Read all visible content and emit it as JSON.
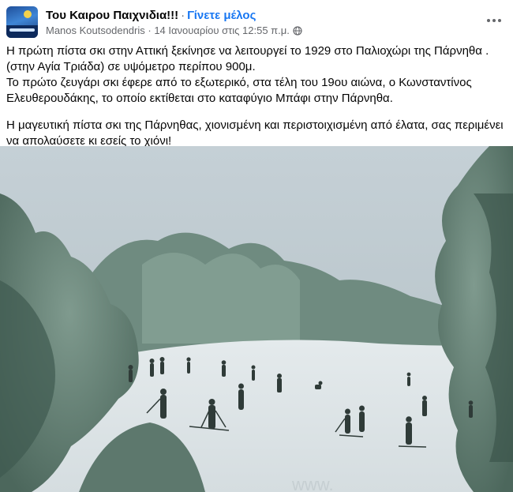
{
  "header": {
    "group_name": "Του Καιρου Παιχνιδια!!!",
    "separator": "·",
    "join_label": "Γίνετε μέλος",
    "author": "Manos Koutsodendris",
    "meta_sep": " · ",
    "timestamp": "14 Ιανουαρίου στις 12:55 π.μ.",
    "privacy_icon": "globe-icon",
    "more_icon": "more-options-icon"
  },
  "post": {
    "paragraph1_line1": "Η πρώτη πίστα σκι στην Αττική ξεκίνησε να λειτουργεί το 1929 στο Παλιοχώρι της Πάρνηθα .(στην Αγία Τριάδα) σε υψόμετρο περίπου 900μ.",
    "paragraph1_line2": "Το πρώτο ζευγάρι σκι έφερε από το εξωτερικό, στα τέλη του 19ου αιώνα, ο Κωνσταντίνος Ελευθερουδάκης, το οποίο εκτίθεται  στο καταφύγιο Μπάφι στην Πάρνηθα.",
    "paragraph2": "Η μαγευτική πίστα σκι της Πάρνηθας, χιονισμένη και  περιστοιχισμένη από έλατα, σας περιμένει να απολαύσετε κι εσείς το χιόνι!"
  },
  "colors": {
    "link_blue": "#1877f2",
    "secondary_text": "#65676b",
    "primary_text": "#050505"
  }
}
